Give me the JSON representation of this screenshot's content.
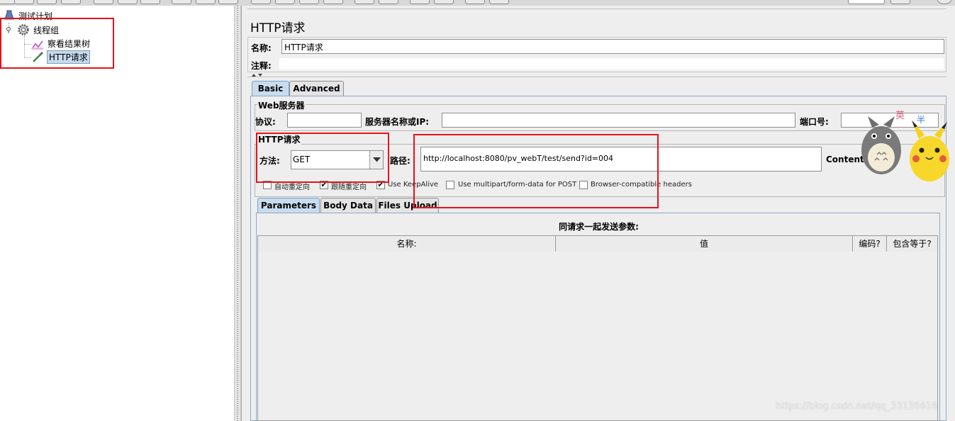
{
  "tree": {
    "items": [
      {
        "label": "测试计划"
      },
      {
        "label": "线程组"
      },
      {
        "label": "察看结果树"
      },
      {
        "label": "HTTP请求"
      }
    ]
  },
  "panel": {
    "title": "HTTP请求",
    "name_label": "名称:",
    "name_value": "HTTP请求",
    "comment_label": "注释:",
    "comment_value": "",
    "tabs": [
      {
        "label": "Basic",
        "active": true
      },
      {
        "label": "Advanced",
        "active": false
      }
    ]
  },
  "web_server": {
    "group_title": "Web服务器",
    "protocol_label": "协议:",
    "protocol_value": "",
    "server_label": "服务器名称或IP:",
    "server_value": "",
    "port_label": "端口号:",
    "port_value": ""
  },
  "http_request": {
    "group_title": "HTTP请求",
    "method_label": "方法:",
    "method_value": "GET",
    "path_label": "路径:",
    "path_value": "http://localhost:8080/pv_webT/test/send?id=004",
    "content_encoding_label": "Content e"
  },
  "options": [
    {
      "label": "自动重定向",
      "checked": false
    },
    {
      "label": "跟随重定向",
      "checked": true
    },
    {
      "label": "Use KeepAlive",
      "checked": true
    },
    {
      "label": "Use multipart/form-data for POST",
      "checked": false
    },
    {
      "label": "Browser-compatible headers",
      "checked": false
    }
  ],
  "sub_tabs": [
    {
      "label": "Parameters",
      "active": true
    },
    {
      "label": "Body Data",
      "active": false
    },
    {
      "label": "Files Upload",
      "active": false
    }
  ],
  "params_table": {
    "caption": "同请求一起发送参数:",
    "columns": [
      "名称:",
      "值",
      "编码?",
      "包含等于?"
    ],
    "rows": []
  },
  "overlay": {
    "badge_chars": [
      "英",
      "半"
    ],
    "watermark": "https://blog.csdn.net/qq_33136616"
  },
  "colors": {
    "highlight_red": "#e3141b",
    "selected_tab": "#c8dcef",
    "selected_tree": "#c6d9ee"
  },
  "icons": [
    "test-plan-icon",
    "thread-group-gear-icon",
    "result-tree-icon",
    "sampler-pipette-icon",
    "dropdown-arrow-icon"
  ]
}
